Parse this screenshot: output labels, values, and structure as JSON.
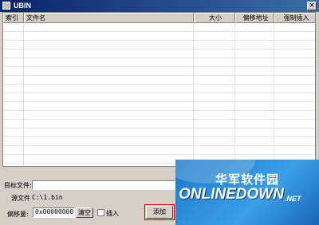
{
  "window": {
    "title": "UBIN",
    "close_label": "×"
  },
  "list": {
    "columns": [
      {
        "label": "索引"
      },
      {
        "label": "文件名"
      },
      {
        "label": "大小"
      },
      {
        "label": "偏移地址"
      },
      {
        "label": "强制插入"
      }
    ]
  },
  "form": {
    "target_label": "目标文件:",
    "target_value": "",
    "source_label": "源文件",
    "source_value": "C:\\1.bin",
    "offset_label": "偏移量:",
    "offset_value": "0x00000000",
    "clear_label": "清空",
    "insert_label": "插入",
    "insert_checked": false,
    "add_label": "添加"
  },
  "watermark": {
    "cn": "华军软件园",
    "en": "ONLINEDOWN",
    "net": ".NET"
  }
}
